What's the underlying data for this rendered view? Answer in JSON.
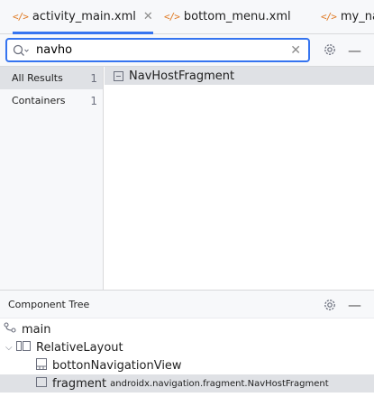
{
  "tabs": [
    {
      "label": "activity_main.xml",
      "icon": "xml-file-icon",
      "active": true,
      "closable": true
    },
    {
      "label": "bottom_menu.xml",
      "icon": "xml-file-icon",
      "active": false
    },
    {
      "label": "my_na",
      "icon": "xml-file-icon",
      "active": false
    }
  ],
  "xml_icon_text": "</>",
  "close_glyph": "✕",
  "search": {
    "value": "navho",
    "clear_glyph": "✕"
  },
  "filters": [
    {
      "label": "All Results",
      "count": "1",
      "selected": true
    },
    {
      "label": "Containers",
      "count": "1",
      "selected": false
    }
  ],
  "results": [
    {
      "label": "NavHostFragment",
      "icon": "view-class-icon"
    }
  ],
  "component_tree": {
    "title": "Component Tree",
    "nodes": [
      {
        "label": "main",
        "icon": "navigation-graph-icon"
      },
      {
        "label": "RelativeLayout",
        "icon": "relative-layout-icon",
        "expanded": true
      },
      {
        "label": "bottonNavigationView",
        "icon": "bottom-navigation-icon"
      },
      {
        "label": "fragment",
        "sublabel": "androidx.navigation.fragment.NavHostFragment",
        "icon": "fragment-icon",
        "selected": true
      }
    ]
  },
  "colors": {
    "accent": "#3574f0",
    "xml_icon": "#e07b25",
    "selection": "#dfe1e5"
  }
}
